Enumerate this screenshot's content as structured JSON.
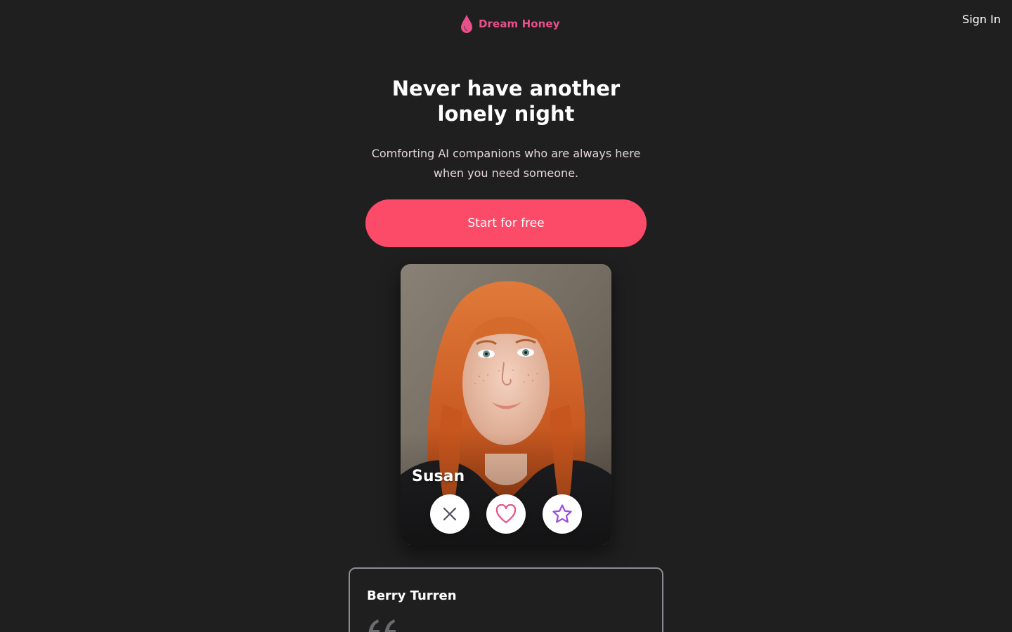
{
  "header": {
    "brand_name": "Dream Honey",
    "brand_icon": "drop-icon",
    "sign_in_label": "Sign In"
  },
  "hero": {
    "title": "Never have another lonely night",
    "subtitle": "Comforting AI companions who are always here when you need someone.",
    "cta_label": "Start for free"
  },
  "profile_card": {
    "name": "Susan",
    "actions": [
      {
        "icon": "close-icon"
      },
      {
        "icon": "heart-icon"
      },
      {
        "icon": "star-icon"
      }
    ]
  },
  "testimonial": {
    "author": "Berry Turren",
    "icon": "quote-icon"
  },
  "colors": {
    "background": "#1f1f20",
    "brand": "#e8508a",
    "cta": "#fb4b68",
    "heart": "#e8508a",
    "star": "#9b4be0",
    "close": "#4a4f57"
  }
}
